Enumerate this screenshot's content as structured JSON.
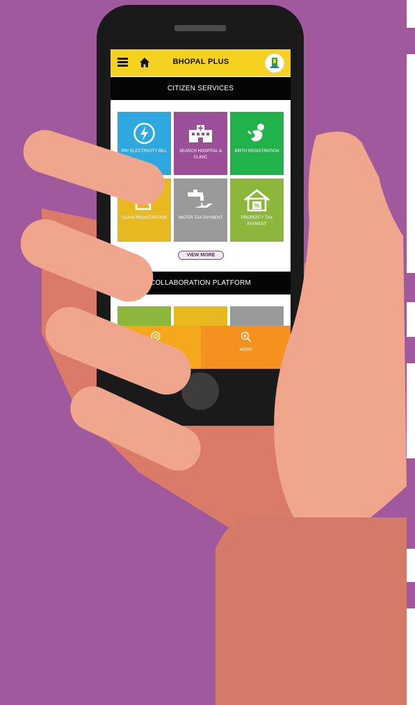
{
  "app": {
    "title": "BHOPAL PLUS"
  },
  "sections": {
    "citizen_services": "CITIZEN SERVICES",
    "collaboration": "COLLABORATION PLATFORM"
  },
  "tiles": [
    {
      "label": "PAY ELECTRICITY BILL",
      "color": "#2ea9e0",
      "icon": "lightning-icon"
    },
    {
      "label": "SEARCH HOSPITAL & CLINIC",
      "color": "#9b4f99",
      "icon": "hospital-icon"
    },
    {
      "label": "BIRTH REGISTRATION",
      "color": "#22b24c",
      "icon": "baby-icon"
    },
    {
      "label": "CLAIM REGISTRATION",
      "color": "#e8b820",
      "icon": "document-icon"
    },
    {
      "label": "WATER TAX PAYMENT",
      "color": "#9a9a9a",
      "icon": "water-tap-icon"
    },
    {
      "label": "PROPERTY TAX PAYMENT",
      "color": "#8db63c",
      "icon": "house-percent-icon"
    }
  ],
  "view_more": "VIEW MORE",
  "bottom_nav": {
    "left_label": "",
    "right_label": "MORE"
  },
  "colors": {
    "background": "#a0599c",
    "topbar": "#f5d21f",
    "section_bar": "#050505",
    "nav_left": "#f6a81c",
    "nav_right": "#f5921f"
  }
}
